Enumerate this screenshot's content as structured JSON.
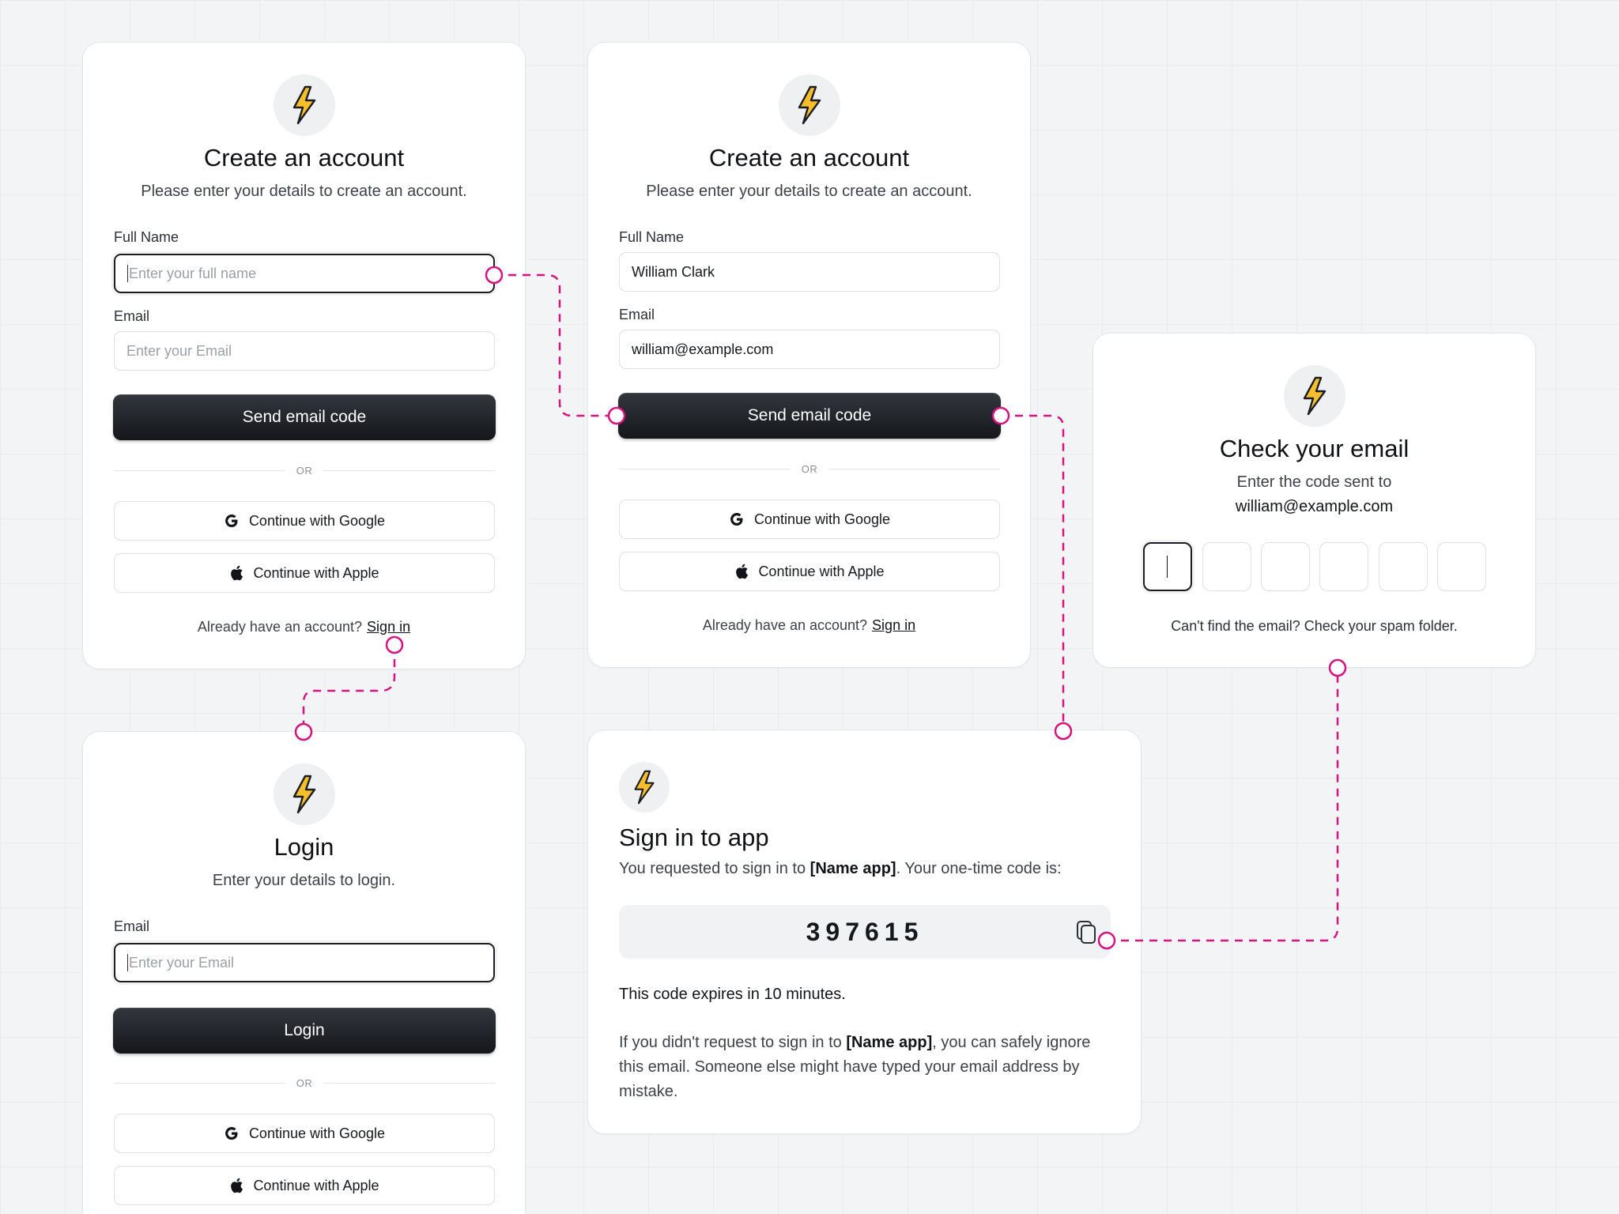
{
  "colors": {
    "connector": "#d6137f",
    "primary_button": "#1b1d22",
    "bolt_fill": "#f6be2c",
    "background": "#f3f4f6"
  },
  "logo_icon": "lightning-bolt-icon",
  "create_empty": {
    "title": "Create an account",
    "subtitle": "Please enter your details to create an account.",
    "name_label": "Full Name",
    "name_placeholder": "Enter your full name",
    "email_label": "Email",
    "email_placeholder": "Enter your Email",
    "submit": "Send email code",
    "or": "OR",
    "google": "Continue with Google",
    "apple": "Continue with Apple",
    "footer_text": "Already have an account?",
    "footer_link": "Sign in"
  },
  "create_filled": {
    "title": "Create an account",
    "subtitle": "Please enter your details to create an account.",
    "name_label": "Full Name",
    "name_value": "William Clark",
    "email_label": "Email",
    "email_value": "william@example.com",
    "submit": "Send email code",
    "or": "OR",
    "google": "Continue with Google",
    "apple": "Continue with Apple",
    "footer_text": "Already have an account?",
    "footer_link": "Sign in"
  },
  "check_email": {
    "title": "Check your email",
    "subtitle": "Enter the code sent to",
    "email": "william@example.com",
    "code_length": 6,
    "footer": "Can't find the email? Check your spam folder."
  },
  "login": {
    "title": "Login",
    "subtitle": "Enter your details to login.",
    "email_label": "Email",
    "email_placeholder": "Enter your Email",
    "submit": "Login",
    "or": "OR",
    "google": "Continue with Google",
    "apple": "Continue with Apple"
  },
  "sign_in_email": {
    "title": "Sign in to app",
    "intro_pre": "You requested to sign in to ",
    "app_name": "[Name app]",
    "intro_post": ". Your one-time code is:",
    "code": "397615",
    "expires": "This code expires in 10 minutes.",
    "ignore_pre": "If you didn't request to sign in to ",
    "ignore_app_name": "[Name app]",
    "ignore_post": ", you can safely ignore this email. Someone else might have typed your email address by mistake."
  }
}
